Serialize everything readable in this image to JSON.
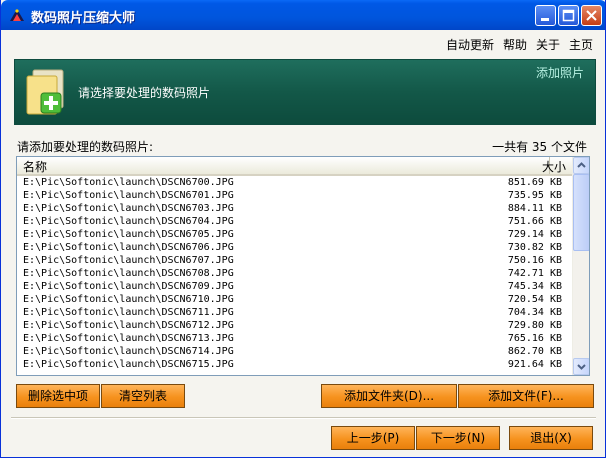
{
  "window": {
    "title": "数码照片压缩大师"
  },
  "menu": [
    {
      "label": "自动更新"
    },
    {
      "label": "帮助"
    },
    {
      "label": "关于"
    },
    {
      "label": "主页"
    }
  ],
  "banner": {
    "text": "请选择要处理的数码照片",
    "add_link": "添加照片"
  },
  "list_section": {
    "label": "请添加要处理的数码照片:",
    "count": "一共有 35 个文件"
  },
  "table": {
    "columns": {
      "name": "名称",
      "size": "大小"
    },
    "rows": [
      {
        "path": "E:\\Pic\\Softonic\\launch\\DSCN6700.JPG",
        "size": "851.69 KB"
      },
      {
        "path": "E:\\Pic\\Softonic\\launch\\DSCN6701.JPG",
        "size": "735.95 KB"
      },
      {
        "path": "E:\\Pic\\Softonic\\launch\\DSCN6703.JPG",
        "size": "884.11 KB"
      },
      {
        "path": "E:\\Pic\\Softonic\\launch\\DSCN6704.JPG",
        "size": "751.66 KB"
      },
      {
        "path": "E:\\Pic\\Softonic\\launch\\DSCN6705.JPG",
        "size": "729.14 KB"
      },
      {
        "path": "E:\\Pic\\Softonic\\launch\\DSCN6706.JPG",
        "size": "730.82 KB"
      },
      {
        "path": "E:\\Pic\\Softonic\\launch\\DSCN6707.JPG",
        "size": "750.16 KB"
      },
      {
        "path": "E:\\Pic\\Softonic\\launch\\DSCN6708.JPG",
        "size": "742.71 KB"
      },
      {
        "path": "E:\\Pic\\Softonic\\launch\\DSCN6709.JPG",
        "size": "745.34 KB"
      },
      {
        "path": "E:\\Pic\\Softonic\\launch\\DSCN6710.JPG",
        "size": "720.54 KB"
      },
      {
        "path": "E:\\Pic\\Softonic\\launch\\DSCN6711.JPG",
        "size": "704.34 KB"
      },
      {
        "path": "E:\\Pic\\Softonic\\launch\\DSCN6712.JPG",
        "size": "729.80 KB"
      },
      {
        "path": "E:\\Pic\\Softonic\\launch\\DSCN6713.JPG",
        "size": "765.16 KB"
      },
      {
        "path": "E:\\Pic\\Softonic\\launch\\DSCN6714.JPG",
        "size": "862.70 KB"
      },
      {
        "path": "E:\\Pic\\Softonic\\launch\\DSCN6715.JPG",
        "size": "921.64 KB"
      }
    ]
  },
  "buttons": {
    "delete_selected": "删除选中项",
    "clear_list": "清空列表",
    "add_folder": "添加文件夹(D)...",
    "add_file": "添加文件(F)...",
    "prev": "上一步(P)",
    "next": "下一步(N)",
    "exit": "退出(X)"
  },
  "icons": {
    "app": "app-icon",
    "minimize": "minimize-icon",
    "maximize": "maximize-icon",
    "close": "close-icon",
    "banner": "add-photo-folder-icon",
    "scroll_up": "scroll-up-icon",
    "scroll_down": "scroll-down-icon"
  },
  "colors": {
    "titlebar": "#0055dc",
    "banner": "#135848",
    "button": "#f6921e"
  }
}
